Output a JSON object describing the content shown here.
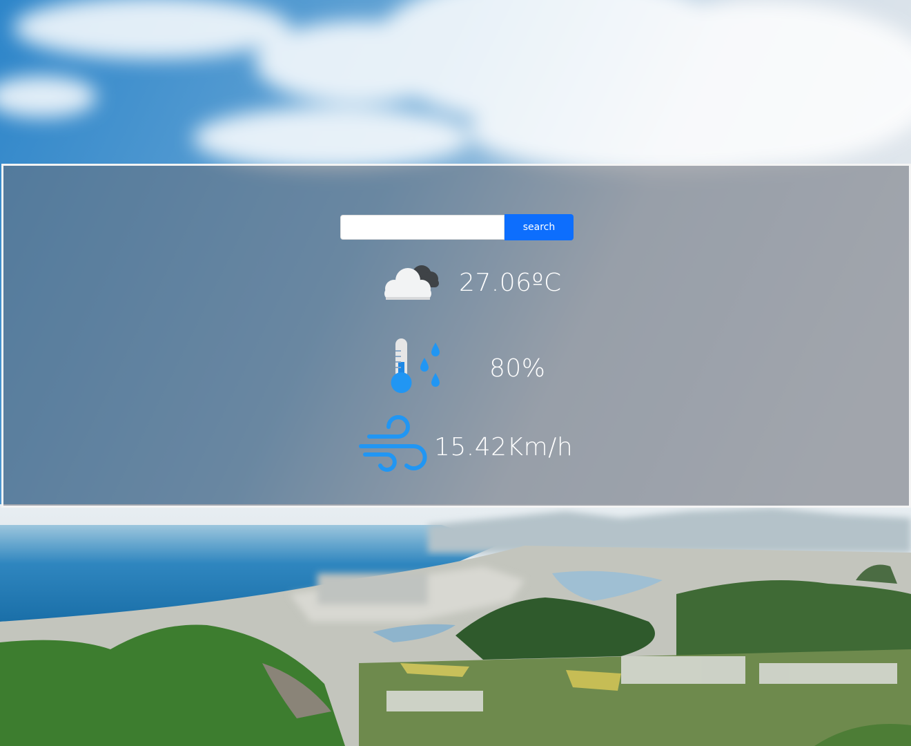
{
  "search": {
    "input_value": "",
    "placeholder": "",
    "button_label": "search"
  },
  "weather": {
    "temperature": "27.06ºC",
    "temperature_icon": "cloud-icon",
    "humidity": "80%",
    "humidity_icon": "thermometer-humidity-icon",
    "wind": "15.42Km/h",
    "wind_icon": "wind-icon"
  },
  "colors": {
    "accent": "#0d6efd",
    "icon_blue": "#2196f3",
    "panel_border": "#f4f4f4",
    "text": "#ffffff"
  }
}
